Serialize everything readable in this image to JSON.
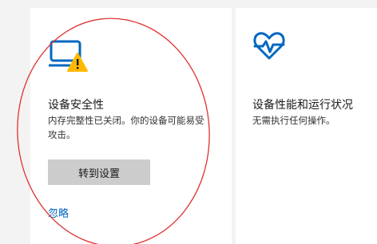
{
  "left_card": {
    "title": "设备安全性",
    "description": "内存完整性已关闭。你的设备可能易受攻击。",
    "button_label": "转到设置",
    "link_label": "忽略",
    "icon": "laptop-warning-icon"
  },
  "right_card": {
    "title": "设备性能和运行状况",
    "description": "无需执行任何操作。",
    "icon": "heart-pulse-icon"
  },
  "colors": {
    "accent": "#0067c0",
    "warning": "#ffb900",
    "annotation": "#e03030"
  }
}
